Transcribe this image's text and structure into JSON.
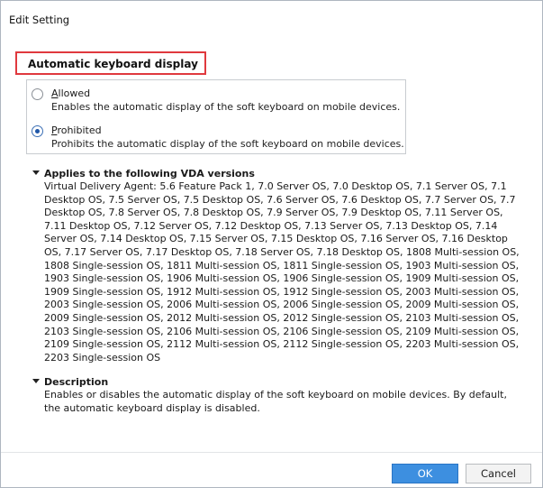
{
  "window": {
    "title": "Edit Setting"
  },
  "setting": {
    "name": "Automatic keyboard display"
  },
  "options": [
    {
      "prefix": "",
      "accel": "A",
      "rest": "llowed",
      "description": "Enables the automatic display of the soft keyboard on mobile devices.",
      "selected": false
    },
    {
      "prefix": "",
      "accel": "P",
      "rest": "rohibited",
      "description": "Prohibits the automatic display of the soft keyboard on mobile devices.",
      "selected": true
    }
  ],
  "vda_section": {
    "header": "Applies to the following VDA versions",
    "body": "Virtual Delivery Agent: 5.6 Feature Pack 1, 7.0 Server OS, 7.0 Desktop OS, 7.1 Server OS, 7.1 Desktop OS, 7.5 Server OS, 7.5 Desktop OS, 7.6 Server OS, 7.6 Desktop OS, 7.7 Server OS, 7.7 Desktop OS, 7.8 Server OS, 7.8 Desktop OS, 7.9 Server OS, 7.9 Desktop OS, 7.11 Server OS, 7.11 Desktop OS, 7.12 Server OS, 7.12 Desktop OS, 7.13 Server OS, 7.13 Desktop OS, 7.14 Server OS, 7.14 Desktop OS, 7.15 Server OS, 7.15 Desktop OS, 7.16 Server OS, 7.16 Desktop OS, 7.17 Server OS, 7.17 Desktop OS, 7.18 Server OS, 7.18 Desktop OS, 1808 Multi-session OS, 1808 Single-session OS, 1811 Multi-session OS, 1811 Single-session OS, 1903 Multi-session OS, 1903 Single-session OS, 1906 Multi-session OS, 1906 Single-session OS, 1909 Multi-session OS, 1909 Single-session OS, 1912 Multi-session OS, 1912 Single-session OS, 2003 Multi-session OS, 2003 Single-session OS, 2006 Multi-session OS, 2006 Single-session OS, 2009 Multi-session OS, 2009 Single-session OS, 2012 Multi-session OS, 2012 Single-session OS, 2103 Multi-session OS, 2103 Single-session OS, 2106 Multi-session OS, 2106 Single-session OS, 2109 Multi-session OS, 2109 Single-session OS, 2112 Multi-session OS, 2112 Single-session OS, 2203 Multi-session OS, 2203 Single-session OS"
  },
  "description_section": {
    "header": "Description",
    "body": "Enables or disables the automatic display of the soft keyboard on mobile devices. By default, the automatic keyboard display is disabled."
  },
  "footer": {
    "ok_label": "OK",
    "cancel_label": "Cancel"
  },
  "colors": {
    "highlight_box": "#e0393e",
    "ok_button": "#3d8fe0",
    "radio_selected": "#1f57a8"
  }
}
